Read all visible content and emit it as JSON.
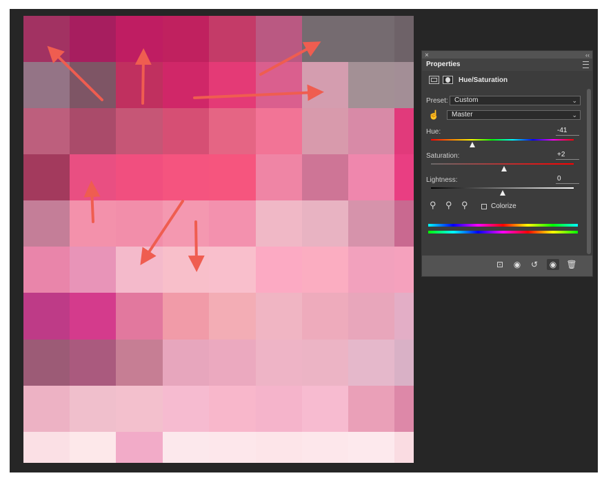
{
  "panel": {
    "title": "Properties",
    "adjustment": "Hue/Saturation",
    "preset_label": "Preset:",
    "preset_value": "Custom",
    "channel_value": "Master",
    "hue": {
      "label": "Hue:",
      "value": "-41",
      "position": 0.29
    },
    "saturation": {
      "label": "Saturation:",
      "value": "+2",
      "position": 0.51
    },
    "lightness": {
      "label": "Lightness:",
      "value": "0",
      "position": 0.5
    },
    "colorize_label": "Colorize",
    "colorize_checked": false
  },
  "colors": {
    "frame_bg": "#262626",
    "panel_bg": "#535353",
    "panel_body_bg": "#3c3c3c",
    "arrow": "#ef5d50"
  },
  "canvas": {
    "description_colors": [
      [
        "#a23262",
        "#a71e5f",
        "#bf1d62",
        "#c0215f",
        "#c43b68",
        "#ba5982",
        "#756b70",
        "#756b70",
        "#6e6268"
      ],
      [
        "#947486",
        "#7e5565",
        "#c0305f",
        "#d02768",
        "#e43a76",
        "#da5f8e",
        "#d49daf",
        "#a39095",
        "#a38e96"
      ],
      [
        "#bd5f7d",
        "#aa4b6a",
        "#c65676",
        "#d64f74",
        "#e56584",
        "#f27496",
        "#d89aac",
        "#d88aa7",
        "#e13a7b"
      ],
      [
        "#a33a5d",
        "#e94f82",
        "#f14f7f",
        "#f5547f",
        "#f6557e",
        "#ef85a5",
        "#ce7596",
        "#ef87ad",
        "#e93e82"
      ],
      [
        "#c47e98",
        "#f391ab",
        "#f28eaa",
        "#f498b0",
        "#f391ae",
        "#f0b8c6",
        "#e8b3c2",
        "#d693ab",
        "#c96990"
      ],
      [
        "#e985aa",
        "#e894b8",
        "#f4bacb",
        "#f8bfca",
        "#f9bfcc",
        "#fcaac3",
        "#fbadc1",
        "#f2a1bd",
        "#f5a1bd"
      ],
      [
        "#be3b87",
        "#d43b8c",
        "#e2789e",
        "#f19ba8",
        "#f3adb5",
        "#f0b5c3",
        "#eeabbc",
        "#e8a6bb",
        "#e3aec6"
      ],
      [
        "#9c5b76",
        "#aa5a7e",
        "#c67e94",
        "#e7a6bd",
        "#eba9bf",
        "#eeb4c6",
        "#ecb4c5",
        "#e5b8cb",
        "#d9b1c6"
      ],
      [
        "#edb2c4",
        "#f0bfcc",
        "#f3c0cd",
        "#f6bbd0",
        "#f8b7cb",
        "#f5b4cb",
        "#f7bbd0",
        "#eaa0b8",
        "#dd88a8"
      ],
      [
        "#fbe0e5",
        "#fde8ea",
        "#f2abc8",
        "#fce8ec",
        "#fde7eb",
        "#fde5e9",
        "#fde7eb",
        "#fde9ed",
        "#fadce2"
      ]
    ]
  }
}
